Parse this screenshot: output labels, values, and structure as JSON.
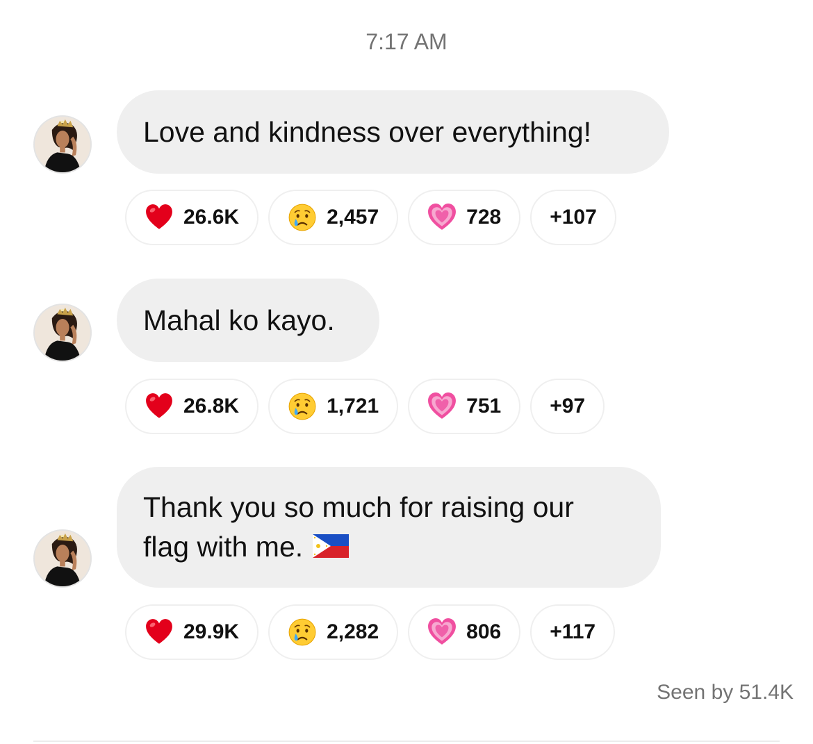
{
  "timestamp": "7:17 AM",
  "messages": [
    {
      "text": "Love and kindness over everything!",
      "reactions": {
        "heart": "26.6K",
        "cry": "2,457",
        "pink_heart": "728",
        "more": "+107"
      }
    },
    {
      "text": "Mahal ko kayo.",
      "reactions": {
        "heart": "26.8K",
        "cry": "1,721",
        "pink_heart": "751",
        "more": "+97"
      }
    },
    {
      "line1": "Thank you so much for raising our",
      "line2": "flag with me.",
      "emoji": "philippines-flag-icon",
      "reactions": {
        "heart": "29.9K",
        "cry": "2,282",
        "pink_heart": "806",
        "more": "+117"
      }
    }
  ],
  "seen": "Seen by 51.4K",
  "icons": {
    "heart": "red-heart-icon",
    "cry": "crying-face-icon",
    "pink_heart": "growing-heart-icon"
  },
  "colors": {
    "bubble": "#efefef",
    "meta_text": "#737373",
    "heart_red": "#e3001b",
    "pink_heart": "#f070b0"
  }
}
